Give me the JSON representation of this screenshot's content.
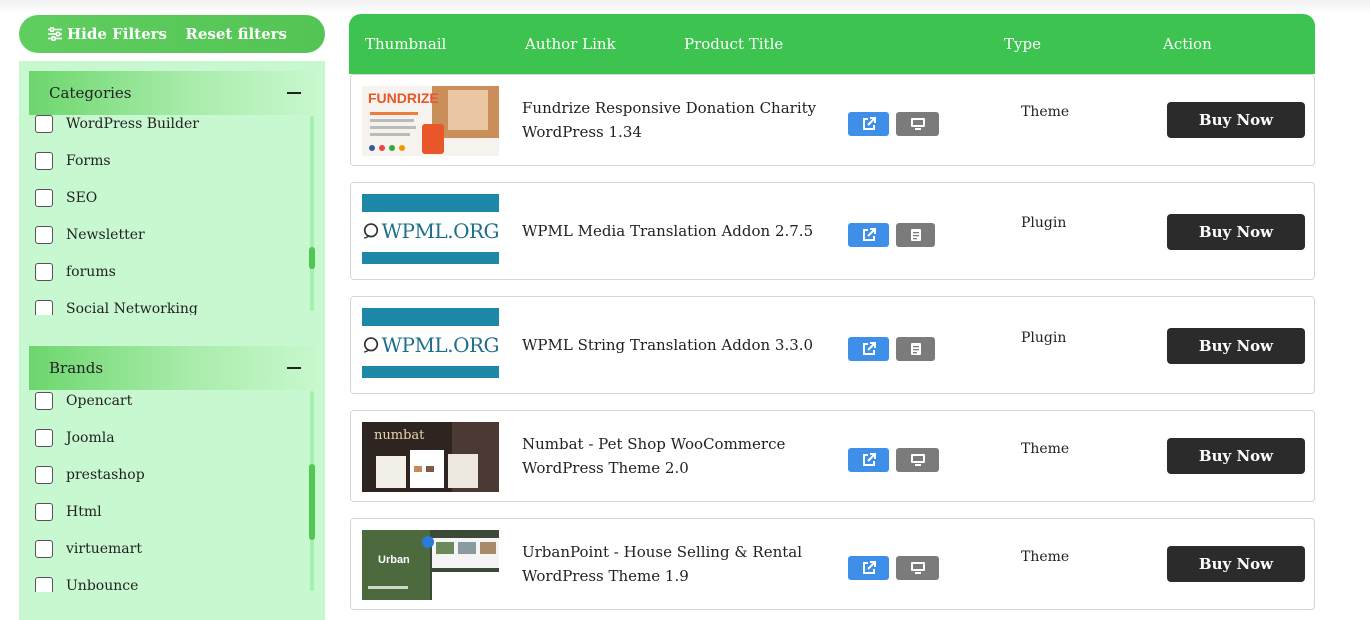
{
  "filters": {
    "hide_label": "Hide Filters",
    "reset_label": "Reset filters"
  },
  "categories": {
    "title": "Categories",
    "items": [
      "WordPress Builder",
      "Forms",
      "SEO",
      "Newsletter",
      "forums",
      "Social Networking"
    ]
  },
  "brands": {
    "title": "Brands",
    "items": [
      "Opencart",
      "Joomla",
      "prestashop",
      "Html",
      "virtuemart",
      "Unbounce"
    ]
  },
  "table": {
    "headers": {
      "thumbnail": "Thumbnail",
      "author": "Author Link",
      "title": "Product Title",
      "type": "Type",
      "action": "Action"
    },
    "buy_label": "Buy Now",
    "rows": [
      {
        "title": "Fundrize Responsive Donation Charity WordPress 1.34",
        "type": "Theme",
        "thumb_text": "FUNDRIZE",
        "demo_icon": "monitor-icon"
      },
      {
        "title": "WPML Media Translation Addon 2.7.5",
        "type": "Plugin",
        "thumb_text": "WPML.ORG",
        "demo_icon": "document-icon"
      },
      {
        "title": "WPML String Translation Addon 3.3.0",
        "type": "Plugin",
        "thumb_text": "WPML.ORG",
        "demo_icon": "document-icon"
      },
      {
        "title": "Numbat - Pet Shop WooCommerce WordPress Theme 2.0",
        "type": "Theme",
        "thumb_text": "numbat",
        "demo_icon": "monitor-icon"
      },
      {
        "title": "UrbanPoint - House Selling & Rental WordPress Theme 1.9",
        "type": "Theme",
        "thumb_text": "Urban",
        "demo_icon": "monitor-icon"
      }
    ]
  },
  "colors": {
    "accent_green": "#3cc350",
    "sidebar_bg": "#c8f8cf",
    "link_blue": "#3d8fe8",
    "demo_gray": "#7b7b7b",
    "buy_black": "#2b2b2b"
  }
}
